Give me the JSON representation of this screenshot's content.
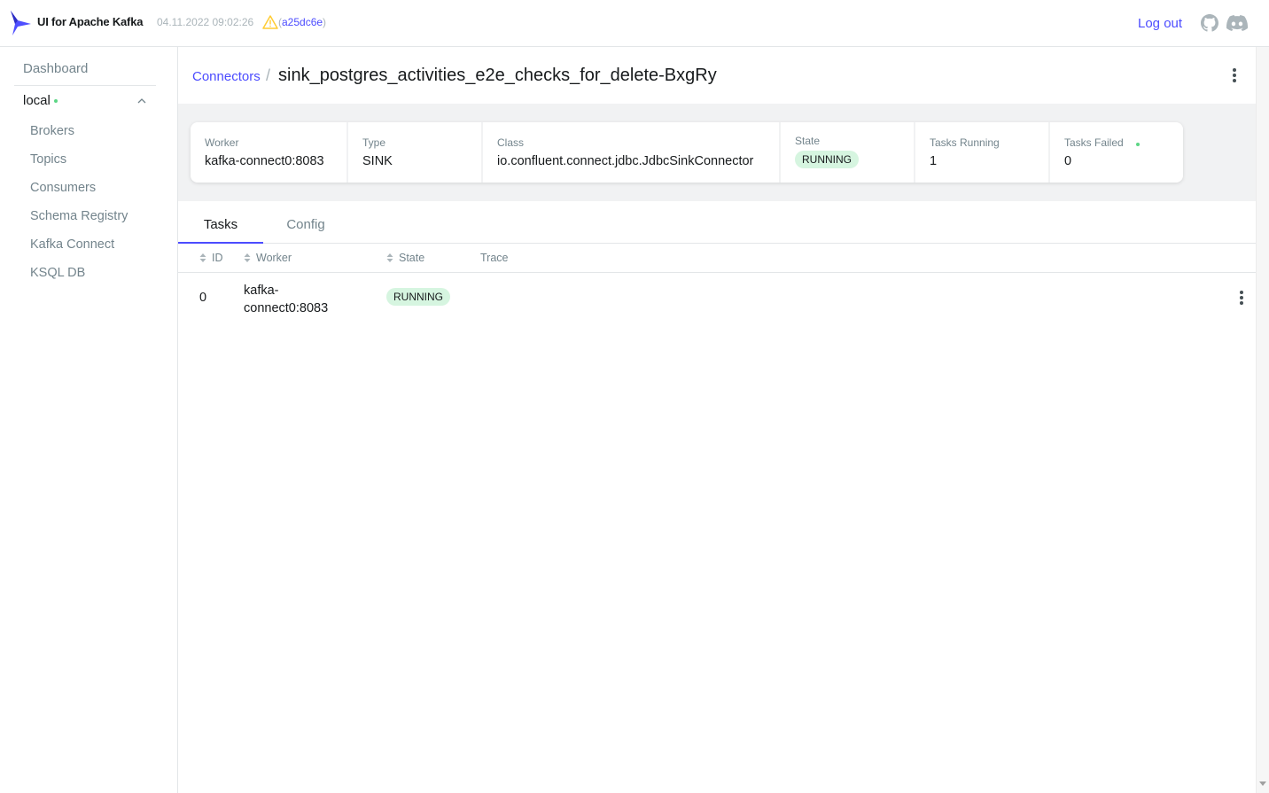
{
  "header": {
    "app_title": "UI for Apache Kafka",
    "build_time": "04.11.2022 09:02:26",
    "commit_open": "(",
    "commit_hash": "a25dc6e",
    "commit_close": ")",
    "logout_label": "Log out"
  },
  "sidebar": {
    "dashboard": "Dashboard",
    "cluster_name": "local",
    "cluster_status_color": "#5cd685",
    "items": [
      {
        "label": "Brokers"
      },
      {
        "label": "Topics"
      },
      {
        "label": "Consumers"
      },
      {
        "label": "Schema Registry"
      },
      {
        "label": "Kafka Connect"
      },
      {
        "label": "KSQL DB"
      }
    ]
  },
  "breadcrumb": {
    "parent": "Connectors",
    "separator": "/",
    "title": "sink_postgres_activities_e2e_checks_for_delete-BxgRy"
  },
  "metrics": [
    {
      "label": "Worker",
      "value": "kafka-connect0:8083"
    },
    {
      "label": "Type",
      "value": "SINK"
    },
    {
      "label": "Class",
      "value": "io.confluent.connect.jdbc.JdbcSinkConnector"
    },
    {
      "label": "State",
      "value": "RUNNING"
    },
    {
      "label": "Tasks Running",
      "value": "1"
    },
    {
      "label": "Tasks Failed",
      "value": "0"
    }
  ],
  "tabs": [
    {
      "label": "Tasks",
      "active": true
    },
    {
      "label": "Config",
      "active": false
    }
  ],
  "table": {
    "columns": [
      "ID",
      "Worker",
      "State",
      "Trace"
    ],
    "rows": [
      {
        "id": "0",
        "worker_line1": "kafka-",
        "worker_line2": "connect0:8083",
        "state": "RUNNING",
        "trace": ""
      }
    ]
  },
  "colors": {
    "accent": "#4c4cff",
    "running_tag_bg": "#d6f5e0",
    "status_green": "#5cd685"
  }
}
